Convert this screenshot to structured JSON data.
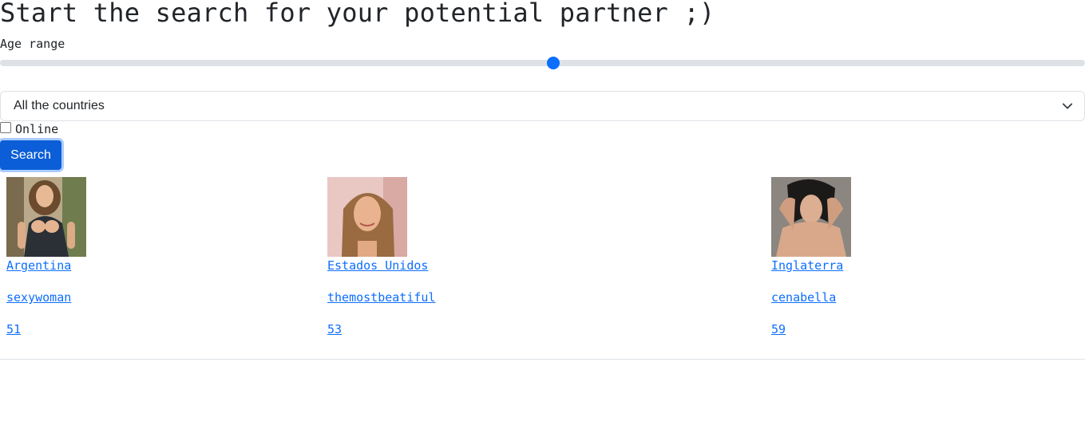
{
  "page": {
    "title": "Start the search for your potential partner ;)"
  },
  "filters": {
    "age_label": "Age range",
    "age_slider_level": 0.51,
    "country_select": {
      "selected": "All the countries"
    },
    "online_label": "Online",
    "online_checked": false,
    "search_label": "Search"
  },
  "results": [
    {
      "country": "Argentina",
      "username": "sexywoman",
      "age": "51"
    },
    {
      "country": "Estados Unidos",
      "username": "themostbeatiful",
      "age": "53"
    },
    {
      "country": "Inglaterra",
      "username": "cenabella",
      "age": "59"
    }
  ],
  "colors": {
    "accent": "#0d6efd",
    "button": "#0b5ed7",
    "track": "#dee2e6",
    "text": "#212529"
  },
  "icons": {
    "select_arrow": "chevron-down-icon"
  }
}
